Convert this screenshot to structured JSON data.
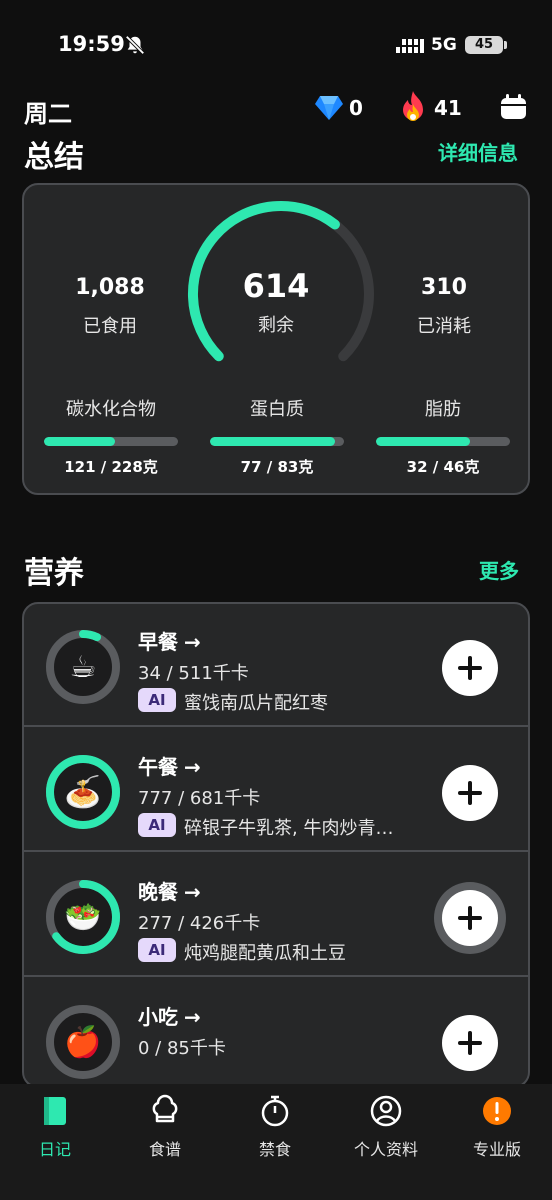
{
  "status": {
    "time": "19:59",
    "network": "5G",
    "battery": "45"
  },
  "header": {
    "day": "周二",
    "gems": "0",
    "streak": "41"
  },
  "summary": {
    "title": "总结",
    "details_link": "详细信息",
    "eaten_value": "1,088",
    "eaten_label": "已食用",
    "remaining_value": "614",
    "remaining_label": "剩余",
    "burned_value": "310",
    "burned_label": "已消耗",
    "remaining_fraction": 0.64,
    "macros": [
      {
        "name": "碳水化合物",
        "amount": "121 / 228克",
        "fraction": 0.53
      },
      {
        "name": "蛋白质",
        "amount": "77 / 83克",
        "fraction": 0.93
      },
      {
        "name": "脂肪",
        "amount": "32 / 46克",
        "fraction": 0.7
      }
    ]
  },
  "nutrition": {
    "title": "营养",
    "more_link": "更多",
    "meals": [
      {
        "name": "早餐",
        "arrow": "→",
        "kcal": "34 / 511千卡",
        "ai": "AI",
        "desc": "蜜饯南瓜片配红枣",
        "emoji": "☕",
        "progress": 0.07
      },
      {
        "name": "午餐",
        "arrow": "→",
        "kcal": "777 / 681千卡",
        "ai": "AI",
        "desc": "碎银子牛乳茶, 牛肉炒青…",
        "emoji": "🍝",
        "progress": 1.0
      },
      {
        "name": "晚餐",
        "arrow": "→",
        "kcal": "277 / 426千卡",
        "ai": "AI",
        "desc": "炖鸡腿配黄瓜和土豆",
        "emoji": "🥗",
        "progress": 0.65
      },
      {
        "name": "小吃",
        "arrow": "→",
        "kcal": "0 / 85千卡",
        "emoji": "🍎",
        "progress": 0
      }
    ]
  },
  "nav": [
    {
      "label": "日记",
      "icon": "diary-book-icon",
      "active": true
    },
    {
      "label": "食谱",
      "icon": "chef-hat-icon"
    },
    {
      "label": "禁食",
      "icon": "stopwatch-icon"
    },
    {
      "label": "个人资料",
      "icon": "profile-icon"
    },
    {
      "label": "专业版",
      "icon": "pro-alert-icon"
    }
  ],
  "colors": {
    "accent": "#2ee8b0",
    "card": "#262728",
    "track": "#5a5c5f",
    "pro": "#ff7a00"
  }
}
